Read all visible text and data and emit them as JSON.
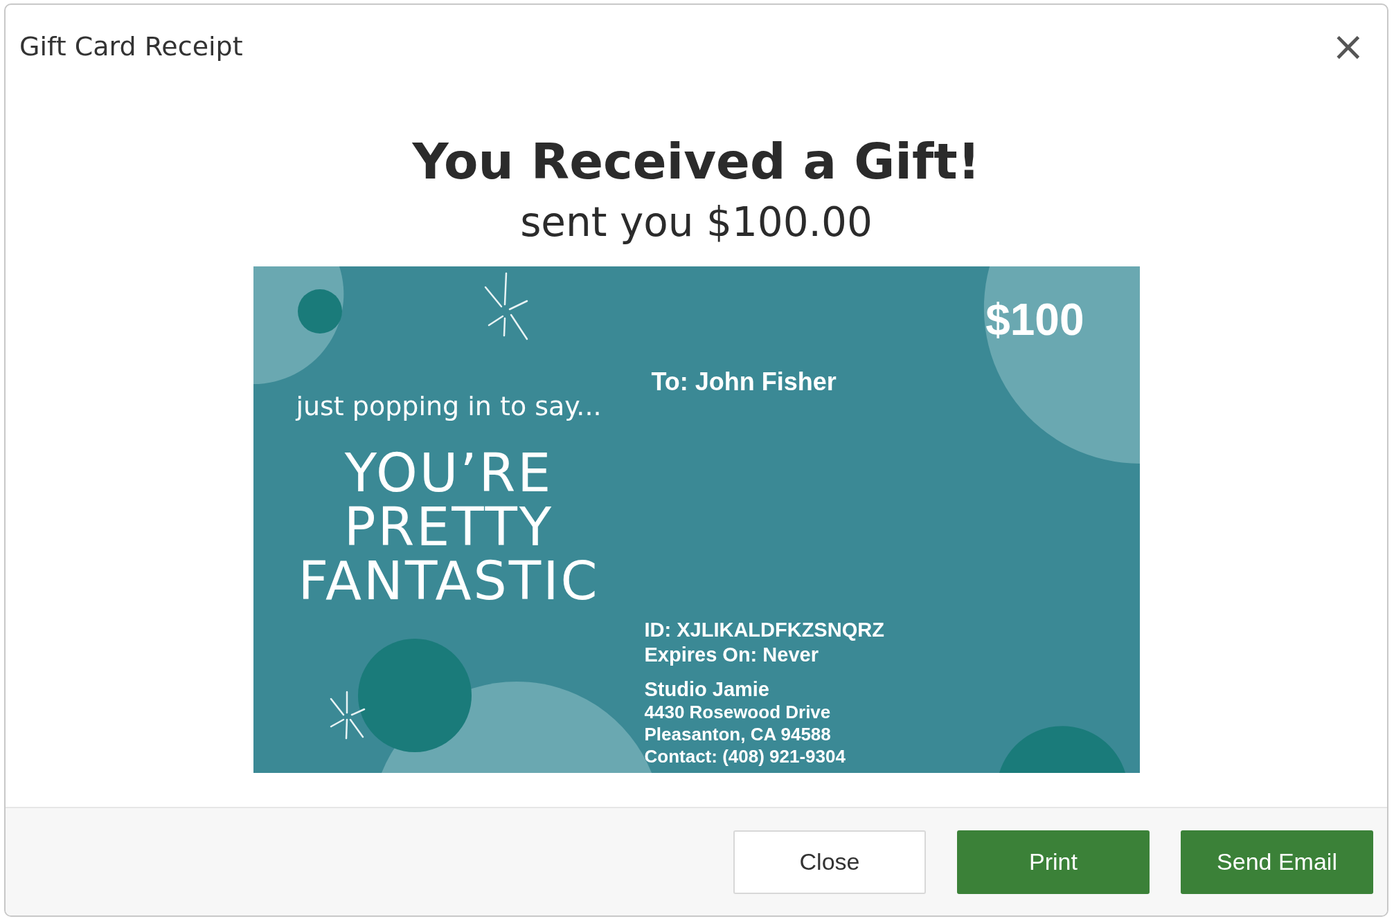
{
  "dialog": {
    "title": "Gift Card Receipt",
    "close_icon": "×"
  },
  "heading": "You Received a Gift!",
  "subheading": "sent you $100.00",
  "card": {
    "amount": "$100",
    "tagline": "just popping in to say...",
    "message_lines": [
      "YOU’RE",
      "PRETTY",
      "FANTASTIC"
    ],
    "recipient": "To: John Fisher",
    "id": "ID: XJLIKALDFKZSNQRZ",
    "expires": "Expires On: Never",
    "business": "Studio Jamie",
    "address_lines": [
      "4430 Rosewood Drive",
      "Pleasanton, CA 94588",
      "Contact: (408) 921-9304"
    ]
  },
  "buttons": [
    {
      "label": "Close",
      "kind": "secondary"
    },
    {
      "label": "Print",
      "kind": "primary"
    },
    {
      "label": "Send Email",
      "kind": "primary"
    }
  ]
}
